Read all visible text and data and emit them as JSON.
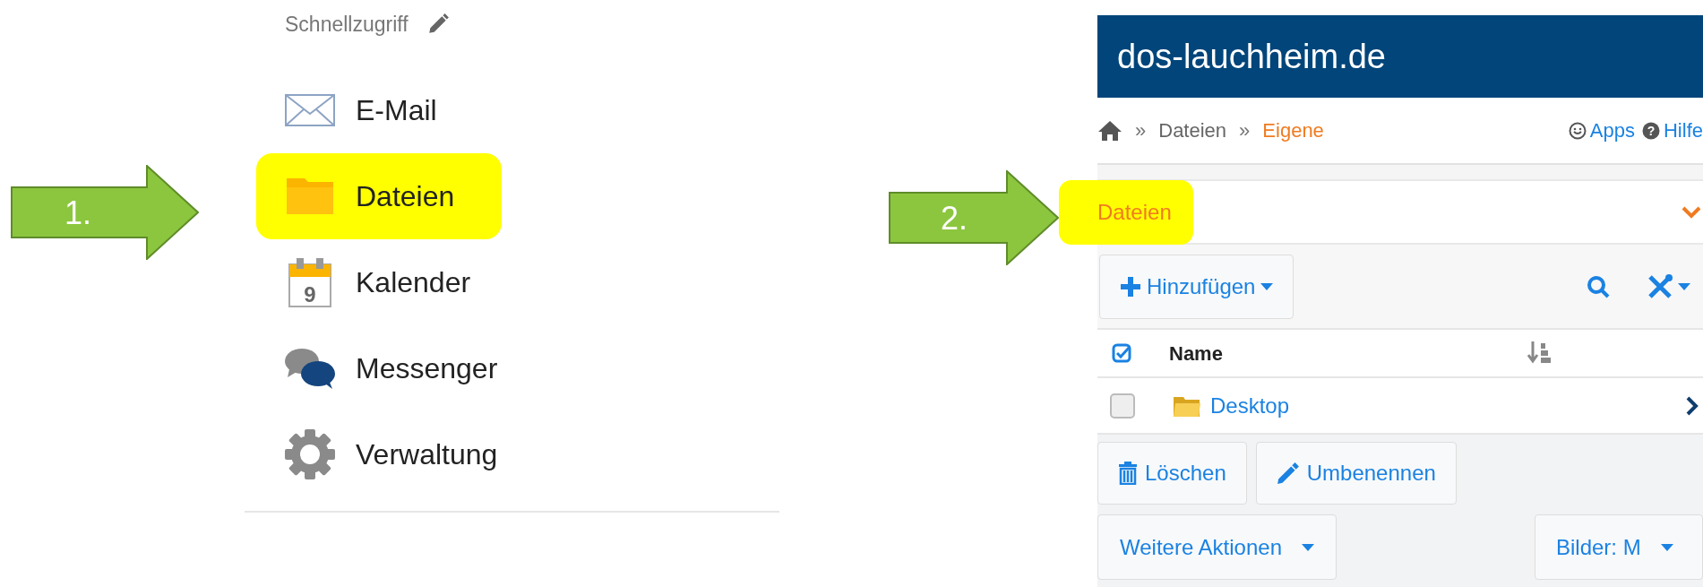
{
  "annotations": [
    {
      "kind": "arrow",
      "label": "1."
    },
    {
      "kind": "arrow",
      "label": "2."
    }
  ],
  "quick_access": {
    "title": "Schnellzugriff",
    "items": [
      {
        "kind": "mail",
        "label": "E-Mail",
        "highlighted": false
      },
      {
        "kind": "folder",
        "label": "Dateien",
        "highlighted": true
      },
      {
        "kind": "calendar",
        "label": "Kalender",
        "day": "9",
        "highlighted": false
      },
      {
        "kind": "chat",
        "label": "Messenger",
        "highlighted": false
      },
      {
        "kind": "gear",
        "label": "Verwaltung",
        "highlighted": false
      }
    ]
  },
  "site": {
    "title": "dos-lauchheim.de",
    "breadcrumb": [
      {
        "separator": "»",
        "label": "Dateien",
        "current": false
      },
      {
        "separator": "»",
        "label": "Eigene",
        "current": true
      }
    ],
    "links": [
      {
        "kind": "apps",
        "label": "Apps"
      },
      {
        "kind": "help",
        "icon_text": "?",
        "label": "Hilfe"
      }
    ],
    "panel": {
      "title": "Dateien",
      "highlighted": true,
      "expanded": true
    },
    "add_button": "Hinzufügen",
    "table": {
      "columns": [
        "Name"
      ],
      "rows": [
        {
          "name": "Desktop",
          "checked": false
        }
      ]
    },
    "actions": [
      {
        "kind": "delete",
        "label": "Löschen"
      },
      {
        "kind": "rename",
        "label": "Umbenennen"
      }
    ],
    "more_actions": "Weitere Aktionen",
    "view_button": "Bilder: M"
  }
}
